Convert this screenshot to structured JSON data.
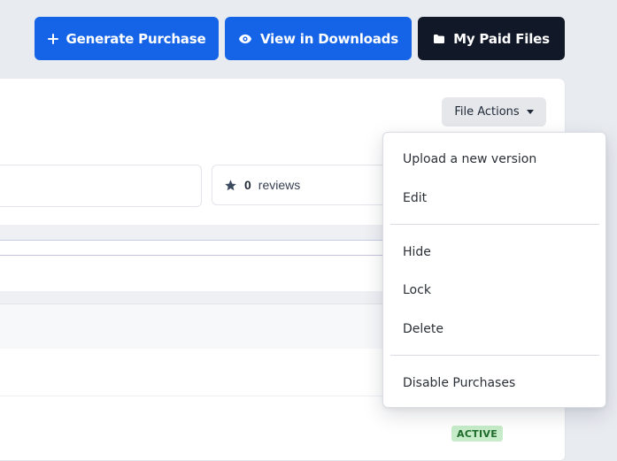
{
  "toolbar": {
    "generate_purchase": "Generate Purchase",
    "view_in_downloads": "View in Downloads",
    "my_paid_files": "My Paid Files"
  },
  "file_actions": {
    "label": "File Actions",
    "menu": {
      "group1": [
        "Upload a new version",
        "Edit"
      ],
      "group2": [
        "Hide",
        "Lock",
        "Delete"
      ],
      "group3": [
        "Disable Purchases"
      ]
    }
  },
  "stats": {
    "reviews_count": "0",
    "reviews_label": "reviews"
  },
  "table": {
    "row_status": "ACTIVE"
  },
  "colors": {
    "primary": "#1564e8",
    "dark": "#111827",
    "active_badge_bg": "#c6ecc9",
    "active_badge_text": "#1e6b2b"
  },
  "icons": {
    "generate": "plus-icon",
    "view": "eye-icon",
    "paid": "folder-icon",
    "reviews": "star-icon",
    "dropdown": "caret-down-icon"
  }
}
